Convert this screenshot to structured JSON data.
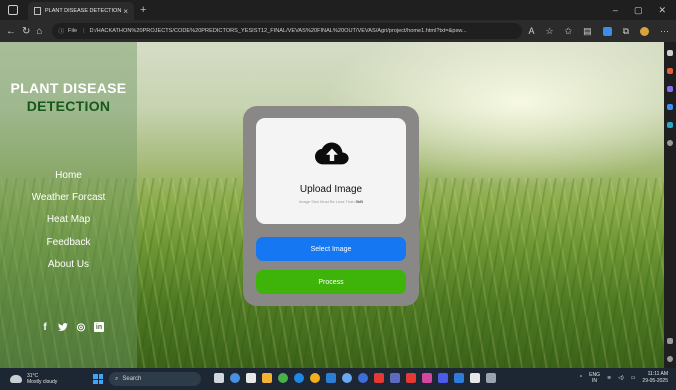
{
  "browser": {
    "tab_title": "PLANT DISEASE DETECTION",
    "tab_close": "×",
    "new_tab": "+",
    "file_label": "File",
    "url": "D:/HACKATHON%20PROJECTS/CODE%20PREDICTORS_YESIST12_FINAL/VEVAS%20FINAL%20OUT/VEVAS/Agri/project/home1.html?txt=&psw...",
    "win_min": "–",
    "win_max": "▢",
    "win_close": "✕"
  },
  "sidebar": {
    "brand_line1": "PLANT DISEASE",
    "brand_line2": "DETECTION",
    "menu": [
      {
        "label": "Home"
      },
      {
        "label": "Weather Forcast"
      },
      {
        "label": "Heat Map"
      },
      {
        "label": "Feedback"
      },
      {
        "label": "About Us"
      }
    ],
    "socials": {
      "facebook": "f",
      "twitter": "🐦",
      "instagram": "◎",
      "linkedin": "in"
    }
  },
  "upload": {
    "icon": "cloud-upload-icon",
    "title": "Upload Image",
    "note_prefix": "Image Size Must Be Less Than ",
    "note_limit": "5kB",
    "select_label": "Select Image",
    "process_label": "Process"
  },
  "colors": {
    "brand_green": "#15591a",
    "select_blue": "#1677f2",
    "process_green": "#3eb30a",
    "card_gray": "#8a8887"
  },
  "taskbar": {
    "temp": "31°C",
    "weather": "Mostly cloudy",
    "search": "Search",
    "lang": "ENG",
    "region": "IN",
    "time": "11:11 AM",
    "date": "29-05-2025"
  }
}
